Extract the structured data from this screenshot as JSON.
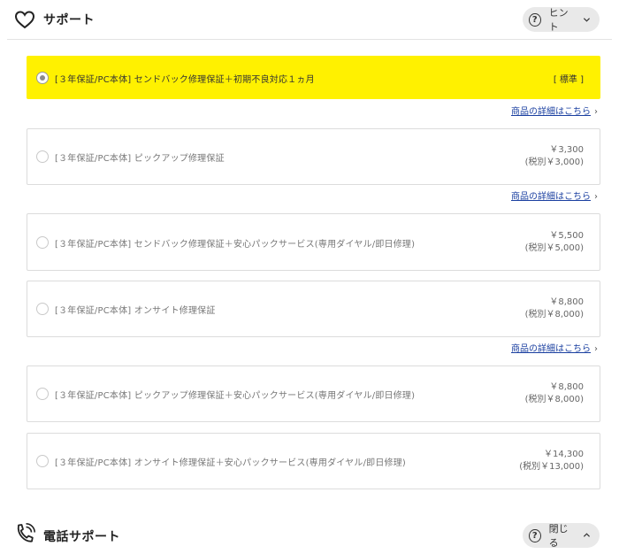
{
  "support": {
    "title": "サポート",
    "hint_label": "ヒント"
  },
  "options": [
    {
      "label": "[３年保証/PC本体] センドバック修理保証＋初期不良対応１ヵ月",
      "badge": "[ 標準 ]",
      "selected": true
    },
    {
      "label": "[３年保証/PC本体] ピックアップ修理保証",
      "price": "￥3,300",
      "price_ex": "(税別￥3,000)"
    },
    {
      "label": "[３年保証/PC本体] センドバック修理保証＋安心パックサービス(専用ダイヤル/即日修理)",
      "price": "￥5,500",
      "price_ex": "(税別￥5,000)"
    },
    {
      "label": "[３年保証/PC本体] オンサイト修理保証",
      "price": "￥8,800",
      "price_ex": "(税別￥8,000)"
    },
    {
      "label": "[３年保証/PC本体] ピックアップ修理保証＋安心パックサービス(専用ダイヤル/即日修理)",
      "price": "￥8,800",
      "price_ex": "(税別￥8,000)"
    },
    {
      "label": "[３年保証/PC本体] オンサイト修理保証＋安心パックサービス(専用ダイヤル/即日修理)",
      "price": "￥14,300",
      "price_ex": "(税別￥13,000)"
    }
  ],
  "detail_link_label": "商品の詳細はこちら",
  "phone_support": {
    "title": "電話サポート",
    "close_label": "閉じる"
  },
  "icons": {
    "heart": "heart-icon",
    "phone": "phone-icon",
    "help": "question-circle-icon",
    "chevron_down": "chevron-down-icon",
    "chevron_up": "chevron-up-icon",
    "chevron_right": "chevron-right-icon"
  },
  "colors": {
    "selected_bg": "#fff100",
    "link": "#1a3fa0",
    "pill_bg": "#e9e9e9"
  }
}
